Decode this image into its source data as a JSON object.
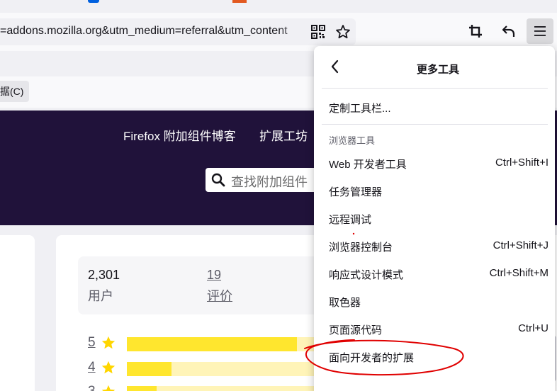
{
  "browser": {
    "url": "=addons.mozilla.org&utm_medium=referral&utm_content",
    "bookmark_label": "据(C)"
  },
  "site": {
    "nav": [
      "Firefox 附加组件博客",
      "扩展工坊"
    ],
    "search_placeholder": "查找附加组件"
  },
  "stats": {
    "users_count": "2,301",
    "users_label": "用户",
    "reviews_count": "19",
    "reviews_label": "评价"
  },
  "ratings": [
    {
      "stars": "5",
      "fraction": 0.8
    },
    {
      "stars": "4",
      "fraction": 0.21
    },
    {
      "stars": "3",
      "fraction": 0.14
    }
  ],
  "menu": {
    "title": "更多工具",
    "customize": "定制工具栏...",
    "section_label": "浏览器工具",
    "items": [
      {
        "label": "Web 开发者工具",
        "shortcut": "Ctrl+Shift+I"
      },
      {
        "label": "任务管理器",
        "shortcut": ""
      },
      {
        "label": "远程调试",
        "shortcut": ""
      },
      {
        "label": "浏览器控制台",
        "shortcut": "Ctrl+Shift+J"
      },
      {
        "label": "响应式设计模式",
        "shortcut": "Ctrl+Shift+M"
      },
      {
        "label": "取色器",
        "shortcut": ""
      },
      {
        "label": "页面源代码",
        "shortcut": "Ctrl+U"
      },
      {
        "label": "面向开发者的扩展",
        "shortcut": ""
      }
    ]
  },
  "colors": {
    "header_bg": "#20123a",
    "rating_fill": "#ffe62e",
    "annotation": "#e00000"
  },
  "icons": [
    "qr-code-icon",
    "star-bookmark-icon",
    "crop-icon",
    "undo-icon",
    "hamburger-menu-icon",
    "search-icon",
    "chevron-left-icon",
    "rating-star-icon"
  ]
}
